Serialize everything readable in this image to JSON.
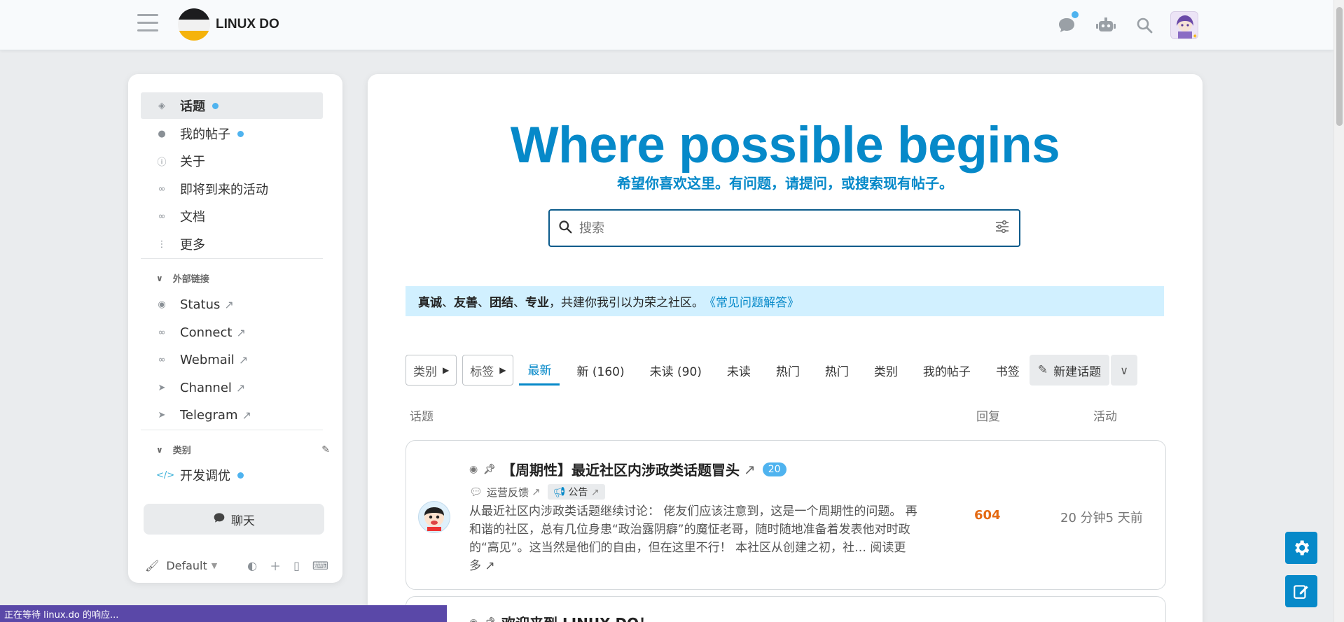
{
  "header": {
    "site_title": "LINUX DO",
    "icons": [
      "menu-icon",
      "chat-icon",
      "robot-icon",
      "search-icon",
      "user-avatar"
    ]
  },
  "sidebar": {
    "items": [
      {
        "label": "话题",
        "icon": "layers-icon",
        "dot": true,
        "active": true
      },
      {
        "label": "我的帖子",
        "icon": "user-icon",
        "dot": true
      },
      {
        "label": "关于",
        "icon": "info-icon"
      },
      {
        "label": "即将到来的活动",
        "icon": "link-icon"
      },
      {
        "label": "文档",
        "icon": "link-icon"
      },
      {
        "label": "更多",
        "icon": "ellipsis-vertical-icon"
      }
    ],
    "external_header": "外部链接",
    "external": [
      {
        "label": "Status",
        "icon": "eye-icon"
      },
      {
        "label": "Connect",
        "icon": "link-icon"
      },
      {
        "label": "Webmail",
        "icon": "link-icon"
      },
      {
        "label": "Channel",
        "icon": "paper-plane-icon"
      },
      {
        "label": "Telegram",
        "icon": "paper-plane-icon"
      }
    ],
    "categories_header": "类别",
    "categories": [
      {
        "label": "开发调优",
        "icon": "code-icon",
        "dot": true
      }
    ],
    "chat_label": "聊天",
    "theme_label": "Default"
  },
  "main": {
    "hero_title": "Where possible begins",
    "hero_subtitle": "希望你喜欢这里。有问题，请提问，或搜索现有帖子。",
    "search_placeholder": "搜索",
    "banner": {
      "w1": "真诚",
      "s1": "、",
      "w2": "友善",
      "s2": "、",
      "w3": "团结",
      "s3": "、",
      "w4": "专业",
      "rest": "，共建你我引以为荣之社区。",
      "link": "《常见问题解答》"
    },
    "filters": {
      "categories": "类别",
      "tags": "标签"
    },
    "tabs": [
      "最新",
      "新 (160)",
      "未读 (90)",
      "未读",
      "热门",
      "热门",
      "类别",
      "我的帖子",
      "书签"
    ],
    "active_tab": "最新",
    "new_topic": "新建话题",
    "columns": {
      "topic": "话题",
      "replies": "回复",
      "activity": "活动"
    },
    "topics": [
      {
        "title": "【周期性】最近社区内涉政类话题冒头",
        "count": "20",
        "category": "运营反馈",
        "tag": "公告",
        "excerpt": "从最近社区内涉政类话题继续讨论： 佬友们应该注意到，这是一个周期性的问题。 再和谐的社区，总有几位身患“政治露阴癖”的魔怔老哥，随时随地准备着发表他对时政的“高见”。这当然是他们的自由，但在这里不行！ 本社区从创建之初，社… 阅读更多 ↗",
        "replies": "604",
        "activity": "20 分钟5 天前"
      },
      {
        "title": "欢迎来到 LINUX DO！"
      }
    ]
  },
  "status_bar": "正在等待 linux.do 的响应..."
}
